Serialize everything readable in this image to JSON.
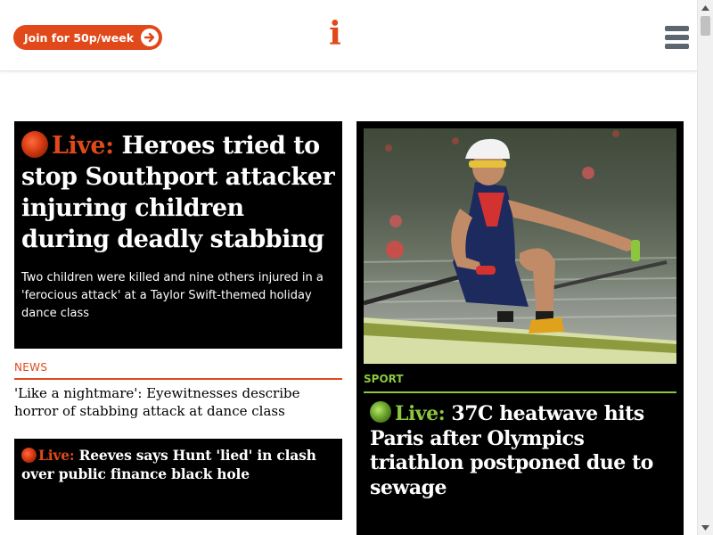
{
  "header": {
    "join_label": "Join for 50p/week",
    "logo_text": "i"
  },
  "colors": {
    "brand": "#e1491b",
    "sport": "#8cc63f"
  },
  "main_story": {
    "live_label": "Live:",
    "headline": "Heroes tried to stop Southport attacker injuring children during deadly stabbing",
    "summary": "Two children were killed and nine others injured in a 'ferocious attack' at a Taylor Swift-themed holiday dance class"
  },
  "news_story": {
    "section": "NEWS",
    "headline": "'Like a nightmare': Eyewitnesses describe horror of stabbing attack at dance class"
  },
  "secondary_live": {
    "live_label": "Live:",
    "headline": "Reeves says Hunt 'lied' in clash over public finance black hole"
  },
  "sport_story": {
    "section": "SPORT",
    "live_label": "Live:",
    "headline": "37C heatwave hits Paris after Olympics triathlon postponed due to sewage"
  },
  "icons": {
    "join_arrow": "arrow-right-circle-icon",
    "menu": "hamburger-menu-icon",
    "live": "live-dot-icon"
  }
}
